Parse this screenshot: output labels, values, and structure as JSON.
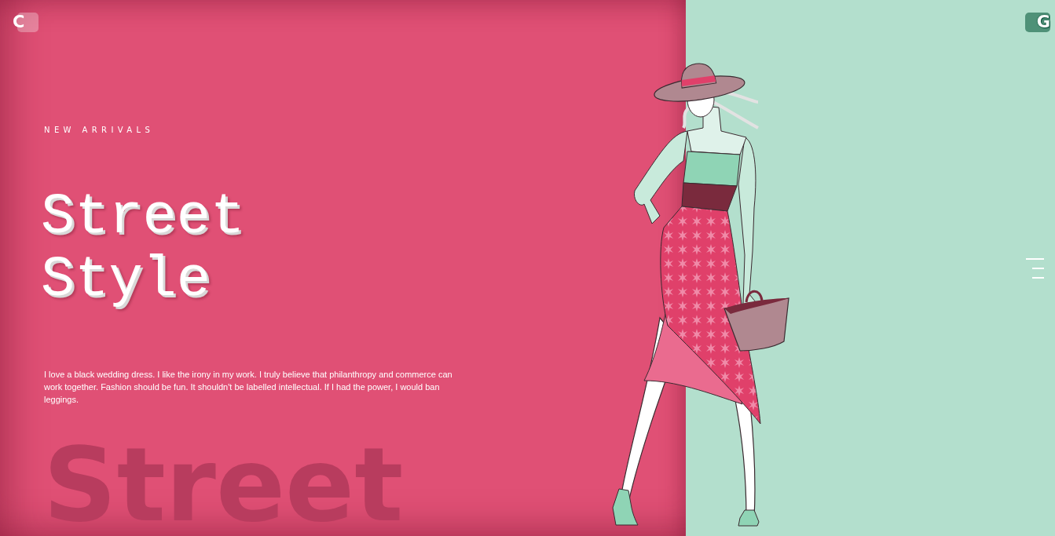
{
  "logo_left": {
    "letter": "C"
  },
  "logo_right": {
    "letter": "G"
  },
  "hero": {
    "eyebrow": "NEW ARRIVALS",
    "heading_lines": [
      "Street",
      "Style"
    ],
    "description": "I love a black wedding dress. I like the irony in my work. I truly believe that philanthropy and commerce can work together. Fashion should be fun. It shouldn't be labelled intellectual. If I had the power, I would ban leggings.",
    "background_word": "Street"
  }
}
